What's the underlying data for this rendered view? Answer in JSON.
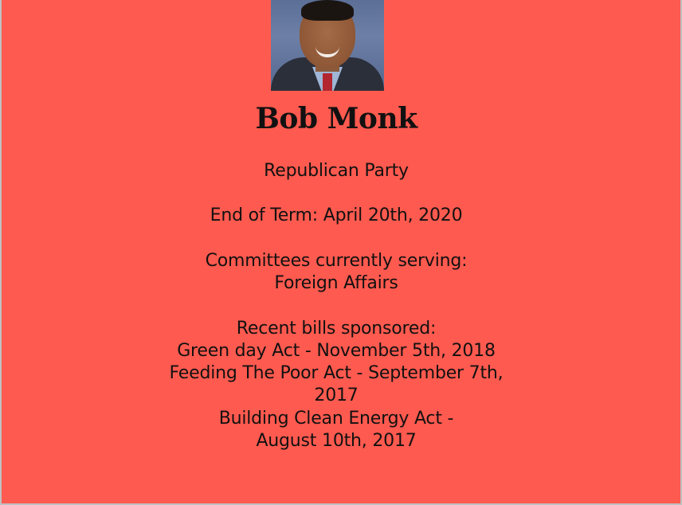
{
  "profile": {
    "name": "Bob Monk",
    "party": "Republican Party",
    "end_of_term": "End of Term: April 20th, 2020",
    "committees_heading": "Committees currently serving:",
    "committees": [
      "Foreign Affairs"
    ],
    "bills_heading": "Recent bills sponsored:",
    "bills_lines": [
      "Green day Act - November 5th, 2018",
      "Feeding The Poor Act - September 7th,",
      "2017",
      "Building Clean Energy Act -",
      "August 10th, 2017"
    ]
  },
  "colors": {
    "background": "#ff5a4f",
    "text": "#111111"
  }
}
